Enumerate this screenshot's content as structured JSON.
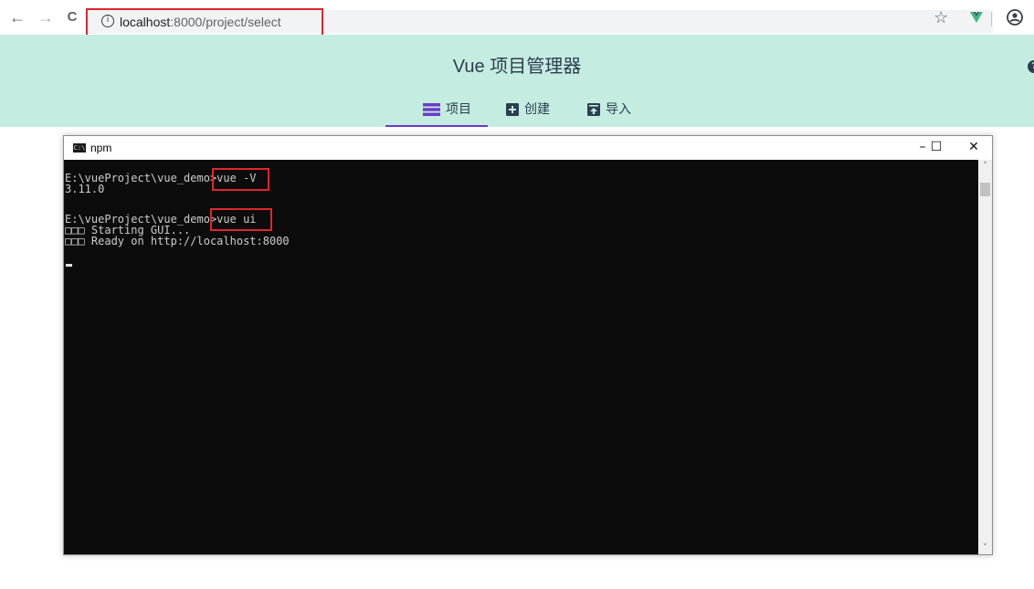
{
  "browser": {
    "back_glyph": "←",
    "forward_glyph": "→",
    "reload_glyph": "C",
    "address_host": "localhost",
    "address_path": ":8000/project/select",
    "info_icon_glyph": "i",
    "star_glyph": "☆",
    "icons": [
      "back-arrow-icon",
      "forward-arrow-icon",
      "reload-icon",
      "info-icon",
      "star-icon",
      "vue-extension-icon",
      "profile-icon"
    ]
  },
  "app": {
    "title": "Vue 项目管理器",
    "help_glyph": "?",
    "background_color": "#c5ece0",
    "accent_color": "#6c3bc9",
    "tabs": [
      {
        "label": "项目",
        "icon": "list-icon",
        "active": true
      },
      {
        "label": "创建",
        "icon": "plus-box-icon",
        "active": false
      },
      {
        "label": "导入",
        "icon": "import-box-icon",
        "active": false
      }
    ]
  },
  "console": {
    "title": "npm",
    "icon_glyph": "C:\\",
    "controls": {
      "minimize": "–",
      "maximize": "☐",
      "close": "✕"
    },
    "lines": [
      "E:\\vueProject\\vue_demo>vue -V",
      "3.11.0",
      "",
      "E:\\vueProject\\vue_demo>vue ui",
      "□□□ Starting GUI...",
      "□□□ Ready on http://localhost:8000"
    ],
    "scroll_up_glyph": "˄",
    "scroll_down_glyph": "˅"
  },
  "highlight_color": "#e0262b"
}
